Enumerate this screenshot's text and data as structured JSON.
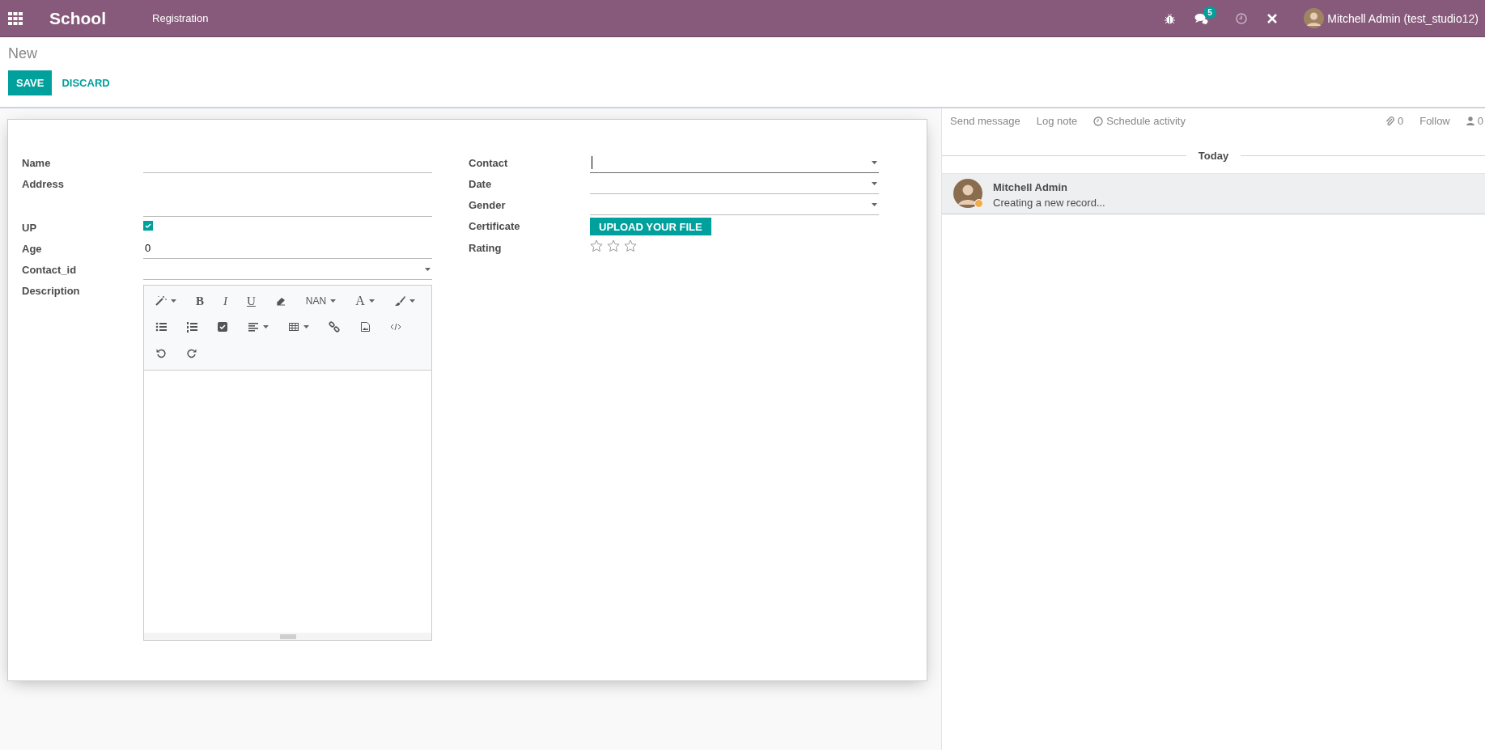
{
  "navbar": {
    "app": "School",
    "menu": [
      "Registration"
    ],
    "notification_count": "5",
    "user": "Mitchell Admin (test_studio12)"
  },
  "breadcrumb": "New",
  "buttons": [
    {
      "label": "SAVE",
      "kind": "primary"
    },
    {
      "label": "DISCARD",
      "kind": "link"
    }
  ],
  "form": {
    "left_fields": [
      {
        "label": "Name",
        "kind": "text"
      },
      {
        "label": "Address",
        "kind": "textarea"
      },
      {
        "label": "UP",
        "kind": "checkbox",
        "checked": true
      },
      {
        "label": "Age",
        "kind": "text",
        "value": "0"
      },
      {
        "label": "Contact_id",
        "kind": "select"
      },
      {
        "label": "Description",
        "kind": "html",
        "toolbar": [
          [
            {
              "kind": "magic",
              "dropdown": true
            },
            {
              "kind": "bold",
              "label": "B",
              "dropdown": false
            },
            {
              "kind": "italic",
              "label": "I",
              "dropdown": false
            },
            {
              "kind": "underline",
              "label": "U",
              "dropdown": false
            },
            {
              "kind": "eraser",
              "dropdown": false
            },
            {
              "kind": "fontsize",
              "label": "NAN",
              "dropdown": true
            },
            {
              "kind": "color",
              "label": "A",
              "dropdown": true
            },
            {
              "kind": "brush",
              "dropdown": true
            }
          ],
          [
            {
              "kind": "ul",
              "dropdown": false
            },
            {
              "kind": "ol",
              "dropdown": false
            },
            {
              "kind": "checklist",
              "dropdown": false
            },
            {
              "kind": "align",
              "dropdown": true
            },
            {
              "kind": "table",
              "dropdown": true
            },
            {
              "kind": "link",
              "dropdown": false
            },
            {
              "kind": "picture",
              "dropdown": false
            },
            {
              "kind": "code",
              "dropdown": false
            }
          ],
          [
            {
              "kind": "undo",
              "dropdown": false
            },
            {
              "kind": "redo",
              "dropdown": false
            }
          ]
        ]
      }
    ],
    "right_fields": [
      {
        "label": "Contact",
        "kind": "select",
        "focused": true
      },
      {
        "label": "Date",
        "kind": "select",
        "focused": false
      },
      {
        "label": "Gender",
        "kind": "select",
        "focused": false
      },
      {
        "label": "Certificate",
        "kind": "upload",
        "button": "UPLOAD YOUR FILE"
      },
      {
        "label": "Rating",
        "kind": "stars",
        "stars": 0
      }
    ]
  },
  "chatter": {
    "actions": [
      "Send message",
      "Log note",
      "Schedule activity"
    ],
    "attachments": "0",
    "follow": "Follow",
    "followers": "0",
    "separator": "Today",
    "messages": [
      {
        "author": "Mitchell Admin",
        "body": "Creating a new record..."
      }
    ]
  }
}
